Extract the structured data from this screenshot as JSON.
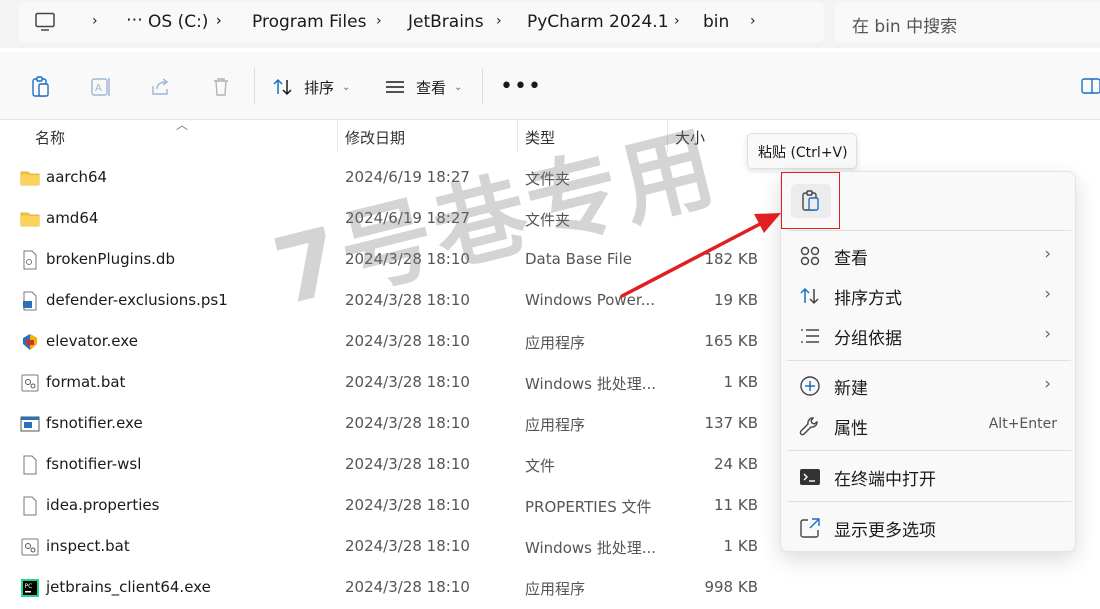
{
  "address_bar": {
    "crumbs": [
      "OS (C:)",
      "Program Files",
      "JetBrains",
      "PyCharm 2024.1",
      "bin"
    ],
    "ellipsis": "⋯",
    "chevron": "›"
  },
  "search": {
    "placeholder": "在 bin 中搜索"
  },
  "toolbar": {
    "sort_label": "排序",
    "view_label": "查看",
    "more_label": "•••",
    "dropdown_caret": "⌄"
  },
  "columns": {
    "name": "名称",
    "date": "修改日期",
    "type": "类型",
    "size": "大小"
  },
  "files": [
    {
      "name": "aarch64",
      "date": "2024/6/19 18:27",
      "type": "文件夹",
      "size": "",
      "icon": "folder-icon"
    },
    {
      "name": "amd64",
      "date": "2024/6/19 18:27",
      "type": "文件夹",
      "size": "",
      "icon": "folder-icon"
    },
    {
      "name": "brokenPlugins.db",
      "date": "2024/3/28 18:10",
      "type": "Data Base File",
      "size": "182 KB",
      "icon": "db-file-icon"
    },
    {
      "name": "defender-exclusions.ps1",
      "date": "2024/3/28 18:10",
      "type": "Windows Power...",
      "size": "19 KB",
      "icon": "powershell-file-icon"
    },
    {
      "name": "elevator.exe",
      "date": "2024/3/28 18:10",
      "type": "应用程序",
      "size": "165 KB",
      "icon": "elevator-exe-icon"
    },
    {
      "name": "format.bat",
      "date": "2024/3/28 18:10",
      "type": "Windows 批处理...",
      "size": "1 KB",
      "icon": "batch-file-icon"
    },
    {
      "name": "fsnotifier.exe",
      "date": "2024/3/28 18:10",
      "type": "应用程序",
      "size": "137 KB",
      "icon": "exe-window-icon"
    },
    {
      "name": "fsnotifier-wsl",
      "date": "2024/3/28 18:10",
      "type": "文件",
      "size": "24 KB",
      "icon": "blank-file-icon"
    },
    {
      "name": "idea.properties",
      "date": "2024/3/28 18:10",
      "type": "PROPERTIES 文件",
      "size": "11 KB",
      "icon": "blank-file-icon"
    },
    {
      "name": "inspect.bat",
      "date": "2024/3/28 18:10",
      "type": "Windows 批处理...",
      "size": "1 KB",
      "icon": "batch-file-icon"
    },
    {
      "name": "jetbrains_client64.exe",
      "date": "2024/3/28 18:10",
      "type": "应用程序",
      "size": "998 KB",
      "icon": "jetbrains-client-icon"
    }
  ],
  "tooltip": {
    "text": "粘贴 (Ctrl+V)"
  },
  "context_menu": {
    "items": [
      {
        "label": "查看",
        "has_submenu": true
      },
      {
        "label": "排序方式",
        "has_submenu": true
      },
      {
        "label": "分组依据",
        "has_submenu": true
      },
      {
        "label": "新建",
        "has_submenu": true
      },
      {
        "label": "属性",
        "shortcut": "Alt+Enter"
      },
      {
        "label": "在终端中打开"
      },
      {
        "label": "显示更多选项"
      }
    ],
    "submenu_chevron": "›"
  },
  "watermark": {
    "text": "7号巷专用"
  },
  "colors": {
    "folder": "#f6c343",
    "accent": "#0067c0",
    "annotation_red": "#e02020"
  }
}
